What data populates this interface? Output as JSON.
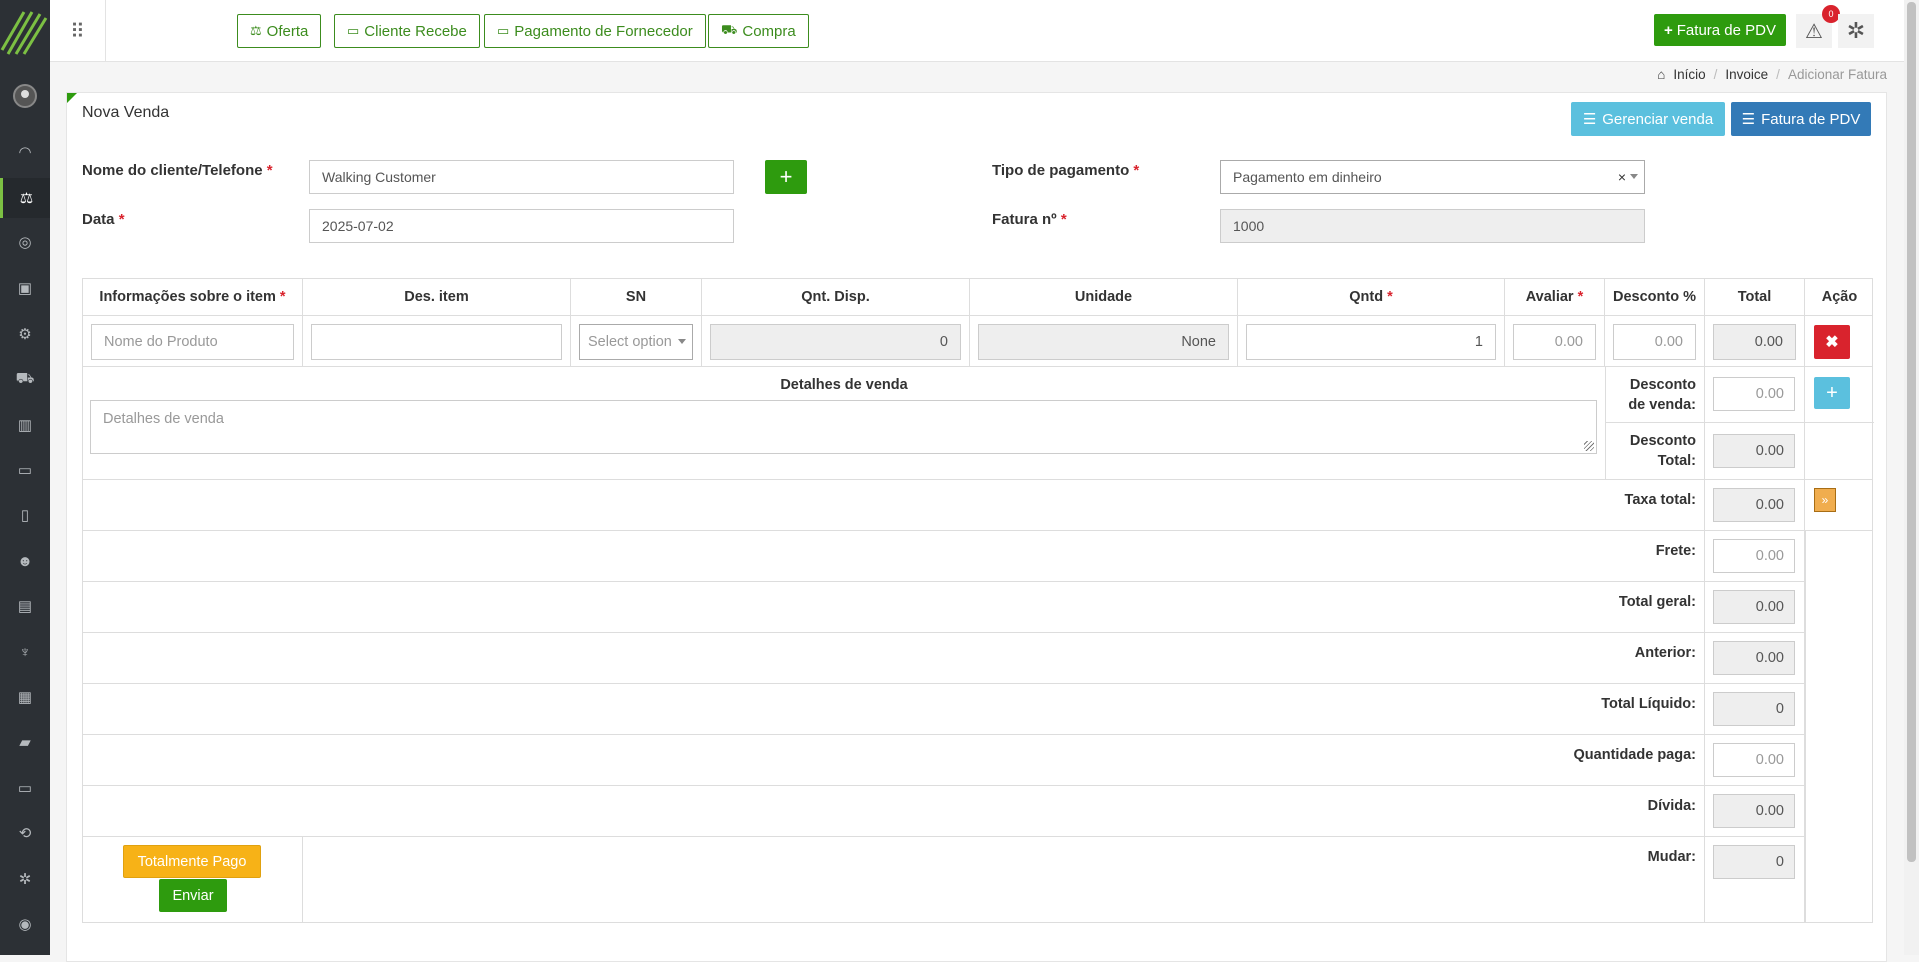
{
  "topbar": {
    "buttons": [
      {
        "icon": "balance-scale-icon",
        "label": "Oferta"
      },
      {
        "icon": "money-icon",
        "label": "Cliente Recebe"
      },
      {
        "icon": "money-icon",
        "label": "Pagamento de Fornecedor"
      },
      {
        "icon": "cart-icon",
        "label": "Compra"
      }
    ],
    "pdv_label": "Fatura de PDV",
    "notification_count": "0"
  },
  "breadcrumb": {
    "home": "Início",
    "invoice": "Invoice",
    "current": "Adicionar Fatura"
  },
  "panel": {
    "title": "Nova Venda",
    "manage_label": "Gerenciar venda",
    "pdv_label": "Fatura de PDV"
  },
  "form": {
    "customer_label": "Nome do cliente/Telefone",
    "customer_value": "Walking Customer",
    "date_label": "Data",
    "date_value": "2025-07-02",
    "payment_label": "Tipo de pagamento",
    "payment_value": "Pagamento em dinheiro",
    "payment_clear": "×",
    "invoice_label": "Fatura nº",
    "invoice_value": "1000",
    "required_mark": "*"
  },
  "table": {
    "headers": [
      "Informações sobre o item",
      "Des. item",
      "SN",
      "Qnt. Disp.",
      "Unidade",
      "Qntd",
      "Avaliar",
      "Desconto %",
      "Total",
      "Ação"
    ],
    "row": {
      "product_placeholder": "Nome do Produto",
      "desc_value": "",
      "sn_placeholder": "Select option",
      "available": "0",
      "unit": "None",
      "qty": "1",
      "rate_placeholder": "0.00",
      "discount_placeholder": "0.00",
      "total": "0.00"
    },
    "details_label": "Detalhes de venda",
    "details_placeholder": "Detalhes de venda",
    "summary": {
      "sale_discount_label_1": "Desconto",
      "sale_discount_label_2": "de venda:",
      "sale_discount_placeholder": "0.00",
      "total_discount_label_1": "Desconto",
      "total_discount_label_2": "Total:",
      "total_discount": "0.00",
      "tax_label": "Taxa total:",
      "tax": "0.00",
      "freight_label": "Frete:",
      "freight_placeholder": "0.00",
      "grand_total_label": "Total geral:",
      "grand_total": "0.00",
      "previous_label": "Anterior:",
      "previous": "0.00",
      "net_total_label": "Total Líquido:",
      "net_total": "0",
      "paid_label": "Quantidade paga:",
      "paid_placeholder": "0.00",
      "due_label": "Dívida:",
      "due": "0.00",
      "change_label": "Mudar:",
      "change": "0"
    },
    "full_paid_label": "Totalmente Pago",
    "submit_label": "Enviar"
  },
  "colors": {
    "primary_green": "#2e9b0e",
    "danger": "#d9232d",
    "info": "#5bc0de",
    "primary": "#337ab7",
    "warning": "#f7b217"
  }
}
